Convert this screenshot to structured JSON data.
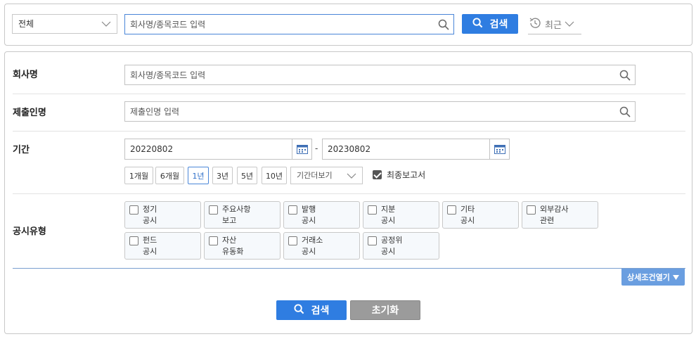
{
  "top_search": {
    "scope_value": "전체",
    "query_placeholder": "회사명/종목코드 입력",
    "search_label": "검색",
    "recent_label": "최근"
  },
  "filters": {
    "company": {
      "label": "회사명",
      "placeholder": "회사명/종목코드 입력"
    },
    "submitter": {
      "label": "제출인명",
      "placeholder": "제출인명 입력"
    },
    "period": {
      "label": "기간",
      "start": "20220802",
      "separator": "-",
      "end": "20230802",
      "presets": [
        "1개월",
        "6개월",
        "1년",
        "3년",
        "5년",
        "10년"
      ],
      "active_preset": "1년",
      "more_label": "기간더보기",
      "final_report_label": "최종보고서",
      "final_report_checked": true
    },
    "disclosure_type": {
      "label": "공시유형",
      "types": [
        {
          "line1": "정기",
          "line2": "공시"
        },
        {
          "line1": "주요사항",
          "line2": "보고"
        },
        {
          "line1": "발행",
          "line2": "공시"
        },
        {
          "line1": "지분",
          "line2": "공시"
        },
        {
          "line1": "기타",
          "line2": "공시"
        },
        {
          "line1": "외부감사",
          "line2": "관련"
        },
        {
          "line1": "펀드",
          "line2": "공시"
        },
        {
          "line1": "자산",
          "line2": "유동화"
        },
        {
          "line1": "거래소",
          "line2": "공시"
        },
        {
          "line1": "공정위",
          "line2": "공시"
        }
      ]
    },
    "detail_toggle_label": "상세조건열기"
  },
  "actions": {
    "search_label": "검색",
    "reset_label": "초기화"
  },
  "colors": {
    "primary": "#2f7de1",
    "secondary": "#9b9b9b",
    "accent": "#6a9ee0"
  },
  "icons": {
    "search": "search-icon",
    "calendar": "calendar-icon",
    "history": "history-clock-icon",
    "chevron": "chevron-down-icon"
  }
}
